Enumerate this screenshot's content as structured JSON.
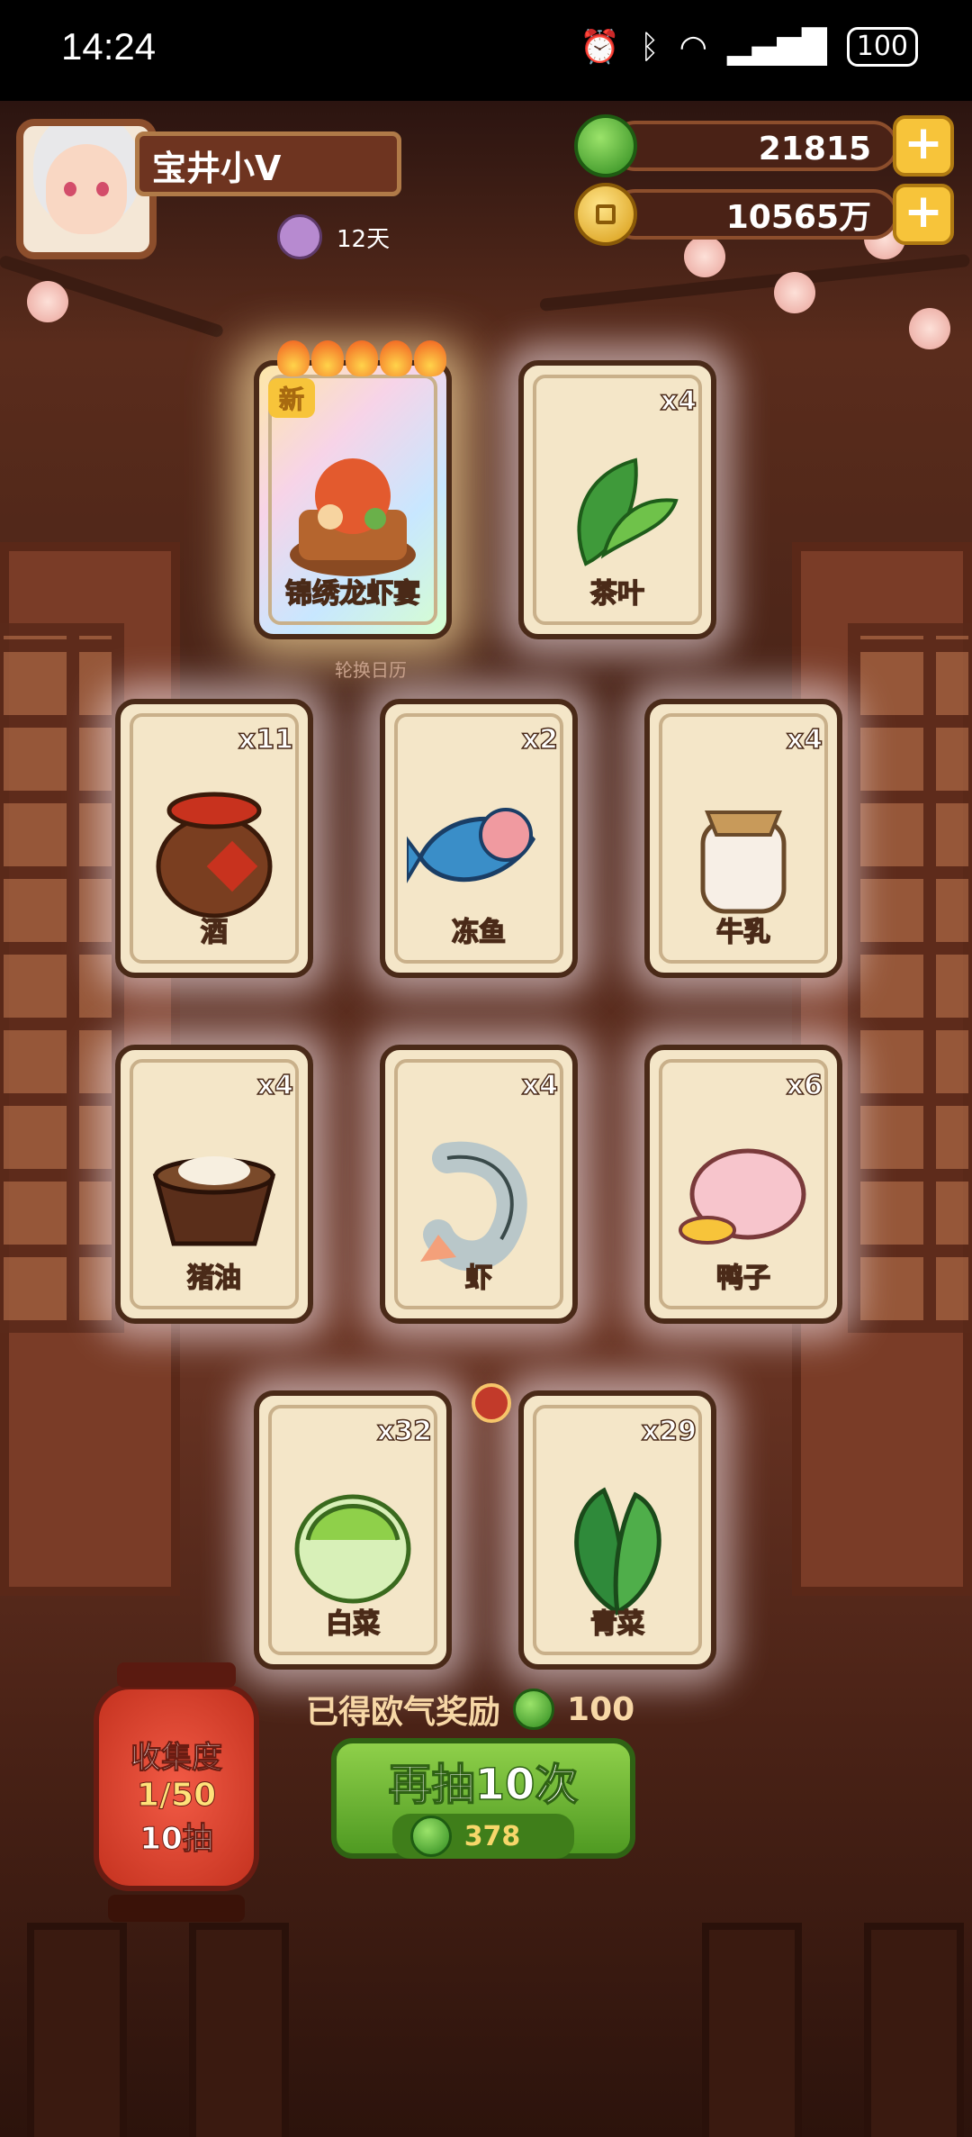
{
  "status_bar": {
    "time": "14:24",
    "battery": "100"
  },
  "player": {
    "name": "宝井小V",
    "days": "12天"
  },
  "currencies": {
    "gems": "21815",
    "coins": "10565万"
  },
  "featured_badge": "新",
  "subcaption": "轮换日历",
  "cards": [
    {
      "label": "锦绣龙虾宴",
      "count": "",
      "rare": true,
      "icon": "lobster-feast-icon"
    },
    {
      "label": "茶叶",
      "count": "x4",
      "icon": "tea-leaf-icon"
    },
    {
      "label": "酒",
      "count": "x11",
      "icon": "wine-jar-icon"
    },
    {
      "label": "冻鱼",
      "count": "x2",
      "icon": "frozen-fish-icon"
    },
    {
      "label": "牛乳",
      "count": "x4",
      "icon": "milk-jar-icon"
    },
    {
      "label": "猪油",
      "count": "x4",
      "icon": "lard-icon"
    },
    {
      "label": "虾",
      "count": "x4",
      "icon": "shrimp-icon"
    },
    {
      "label": "鸭子",
      "count": "x6",
      "icon": "duck-icon"
    },
    {
      "label": "白菜",
      "count": "x32",
      "icon": "cabbage-icon"
    },
    {
      "label": "青菜",
      "count": "x29",
      "icon": "greens-icon"
    }
  ],
  "reward": {
    "text": "已得欧气奖励",
    "value": "100"
  },
  "draw_button": {
    "label": "再抽10次",
    "cost": "378"
  },
  "collection": {
    "title": "收集度",
    "progress": "1/50",
    "draws": "10抽"
  },
  "colors": {
    "green": "#4f9a22",
    "gold": "#f7c43a",
    "wood": "#4a2216"
  }
}
